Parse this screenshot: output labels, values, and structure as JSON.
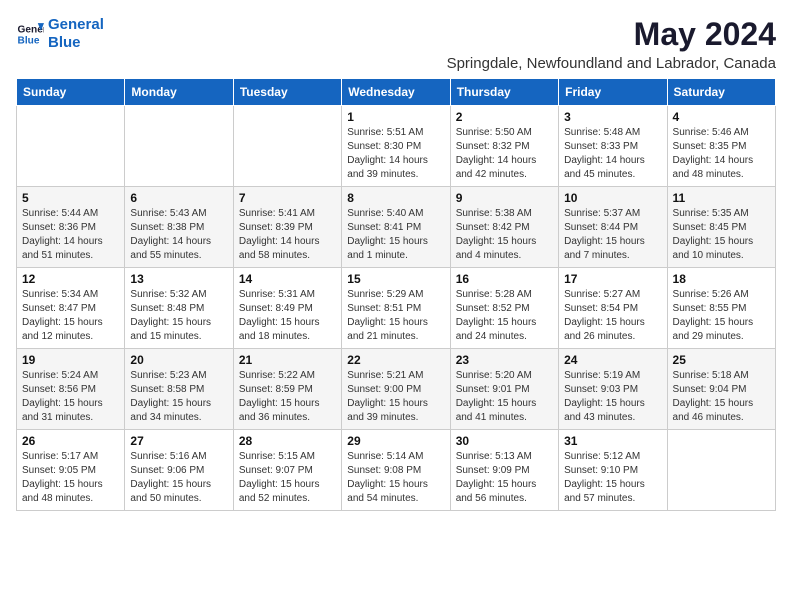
{
  "logo": {
    "line1": "General",
    "line2": "Blue"
  },
  "title": "May 2024",
  "subtitle": "Springdale, Newfoundland and Labrador, Canada",
  "weekdays": [
    "Sunday",
    "Monday",
    "Tuesday",
    "Wednesday",
    "Thursday",
    "Friday",
    "Saturday"
  ],
  "weeks": [
    [
      {
        "day": "",
        "sunrise": "",
        "sunset": "",
        "daylight": ""
      },
      {
        "day": "",
        "sunrise": "",
        "sunset": "",
        "daylight": ""
      },
      {
        "day": "",
        "sunrise": "",
        "sunset": "",
        "daylight": ""
      },
      {
        "day": "1",
        "sunrise": "Sunrise: 5:51 AM",
        "sunset": "Sunset: 8:30 PM",
        "daylight": "Daylight: 14 hours and 39 minutes."
      },
      {
        "day": "2",
        "sunrise": "Sunrise: 5:50 AM",
        "sunset": "Sunset: 8:32 PM",
        "daylight": "Daylight: 14 hours and 42 minutes."
      },
      {
        "day": "3",
        "sunrise": "Sunrise: 5:48 AM",
        "sunset": "Sunset: 8:33 PM",
        "daylight": "Daylight: 14 hours and 45 minutes."
      },
      {
        "day": "4",
        "sunrise": "Sunrise: 5:46 AM",
        "sunset": "Sunset: 8:35 PM",
        "daylight": "Daylight: 14 hours and 48 minutes."
      }
    ],
    [
      {
        "day": "5",
        "sunrise": "Sunrise: 5:44 AM",
        "sunset": "Sunset: 8:36 PM",
        "daylight": "Daylight: 14 hours and 51 minutes."
      },
      {
        "day": "6",
        "sunrise": "Sunrise: 5:43 AM",
        "sunset": "Sunset: 8:38 PM",
        "daylight": "Daylight: 14 hours and 55 minutes."
      },
      {
        "day": "7",
        "sunrise": "Sunrise: 5:41 AM",
        "sunset": "Sunset: 8:39 PM",
        "daylight": "Daylight: 14 hours and 58 minutes."
      },
      {
        "day": "8",
        "sunrise": "Sunrise: 5:40 AM",
        "sunset": "Sunset: 8:41 PM",
        "daylight": "Daylight: 15 hours and 1 minute."
      },
      {
        "day": "9",
        "sunrise": "Sunrise: 5:38 AM",
        "sunset": "Sunset: 8:42 PM",
        "daylight": "Daylight: 15 hours and 4 minutes."
      },
      {
        "day": "10",
        "sunrise": "Sunrise: 5:37 AM",
        "sunset": "Sunset: 8:44 PM",
        "daylight": "Daylight: 15 hours and 7 minutes."
      },
      {
        "day": "11",
        "sunrise": "Sunrise: 5:35 AM",
        "sunset": "Sunset: 8:45 PM",
        "daylight": "Daylight: 15 hours and 10 minutes."
      }
    ],
    [
      {
        "day": "12",
        "sunrise": "Sunrise: 5:34 AM",
        "sunset": "Sunset: 8:47 PM",
        "daylight": "Daylight: 15 hours and 12 minutes."
      },
      {
        "day": "13",
        "sunrise": "Sunrise: 5:32 AM",
        "sunset": "Sunset: 8:48 PM",
        "daylight": "Daylight: 15 hours and 15 minutes."
      },
      {
        "day": "14",
        "sunrise": "Sunrise: 5:31 AM",
        "sunset": "Sunset: 8:49 PM",
        "daylight": "Daylight: 15 hours and 18 minutes."
      },
      {
        "day": "15",
        "sunrise": "Sunrise: 5:29 AM",
        "sunset": "Sunset: 8:51 PM",
        "daylight": "Daylight: 15 hours and 21 minutes."
      },
      {
        "day": "16",
        "sunrise": "Sunrise: 5:28 AM",
        "sunset": "Sunset: 8:52 PM",
        "daylight": "Daylight: 15 hours and 24 minutes."
      },
      {
        "day": "17",
        "sunrise": "Sunrise: 5:27 AM",
        "sunset": "Sunset: 8:54 PM",
        "daylight": "Daylight: 15 hours and 26 minutes."
      },
      {
        "day": "18",
        "sunrise": "Sunrise: 5:26 AM",
        "sunset": "Sunset: 8:55 PM",
        "daylight": "Daylight: 15 hours and 29 minutes."
      }
    ],
    [
      {
        "day": "19",
        "sunrise": "Sunrise: 5:24 AM",
        "sunset": "Sunset: 8:56 PM",
        "daylight": "Daylight: 15 hours and 31 minutes."
      },
      {
        "day": "20",
        "sunrise": "Sunrise: 5:23 AM",
        "sunset": "Sunset: 8:58 PM",
        "daylight": "Daylight: 15 hours and 34 minutes."
      },
      {
        "day": "21",
        "sunrise": "Sunrise: 5:22 AM",
        "sunset": "Sunset: 8:59 PM",
        "daylight": "Daylight: 15 hours and 36 minutes."
      },
      {
        "day": "22",
        "sunrise": "Sunrise: 5:21 AM",
        "sunset": "Sunset: 9:00 PM",
        "daylight": "Daylight: 15 hours and 39 minutes."
      },
      {
        "day": "23",
        "sunrise": "Sunrise: 5:20 AM",
        "sunset": "Sunset: 9:01 PM",
        "daylight": "Daylight: 15 hours and 41 minutes."
      },
      {
        "day": "24",
        "sunrise": "Sunrise: 5:19 AM",
        "sunset": "Sunset: 9:03 PM",
        "daylight": "Daylight: 15 hours and 43 minutes."
      },
      {
        "day": "25",
        "sunrise": "Sunrise: 5:18 AM",
        "sunset": "Sunset: 9:04 PM",
        "daylight": "Daylight: 15 hours and 46 minutes."
      }
    ],
    [
      {
        "day": "26",
        "sunrise": "Sunrise: 5:17 AM",
        "sunset": "Sunset: 9:05 PM",
        "daylight": "Daylight: 15 hours and 48 minutes."
      },
      {
        "day": "27",
        "sunrise": "Sunrise: 5:16 AM",
        "sunset": "Sunset: 9:06 PM",
        "daylight": "Daylight: 15 hours and 50 minutes."
      },
      {
        "day": "28",
        "sunrise": "Sunrise: 5:15 AM",
        "sunset": "Sunset: 9:07 PM",
        "daylight": "Daylight: 15 hours and 52 minutes."
      },
      {
        "day": "29",
        "sunrise": "Sunrise: 5:14 AM",
        "sunset": "Sunset: 9:08 PM",
        "daylight": "Daylight: 15 hours and 54 minutes."
      },
      {
        "day": "30",
        "sunrise": "Sunrise: 5:13 AM",
        "sunset": "Sunset: 9:09 PM",
        "daylight": "Daylight: 15 hours and 56 minutes."
      },
      {
        "day": "31",
        "sunrise": "Sunrise: 5:12 AM",
        "sunset": "Sunset: 9:10 PM",
        "daylight": "Daylight: 15 hours and 57 minutes."
      },
      {
        "day": "",
        "sunrise": "",
        "sunset": "",
        "daylight": ""
      }
    ]
  ]
}
